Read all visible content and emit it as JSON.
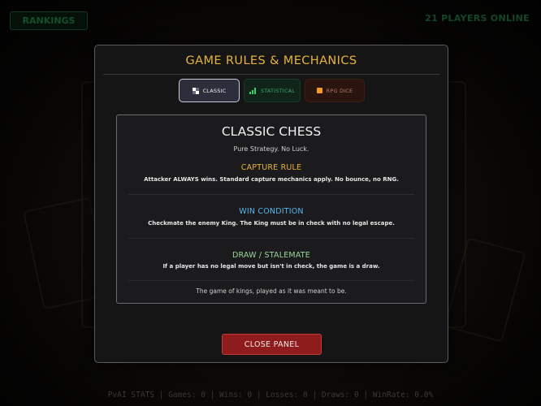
{
  "topbar": {
    "rankings_label": "RANKINGS",
    "online_text": "21 PLAYERS ONLINE"
  },
  "stats_bar": {
    "text": "PvAI STATS | Games: 0 | Wins: 0 | Losses: 0 | Draws: 0 | WinRate: 0.0%"
  },
  "modal": {
    "title": "GAME RULES & MECHANICS",
    "tabs": [
      {
        "label": "CLASSIC",
        "icon": "chessboard-icon",
        "selected": true
      },
      {
        "label": "STATISTICAL",
        "icon": "bar-chart-icon",
        "selected": false
      },
      {
        "label": "RPG DICE",
        "icon": "die-icon",
        "selected": false
      }
    ],
    "panel": {
      "title": "CLASSIC CHESS",
      "subtitle": "Pure Strategy. No Luck.",
      "sections": [
        {
          "heading": "CAPTURE RULE",
          "text": "Attacker ALWAYS wins. Standard capture mechanics apply. No bounce, no RNG.",
          "color": "#e8b33c"
        },
        {
          "heading": "WIN CONDITION",
          "text": "Checkmate the enemy King. The King must be in check with no legal escape.",
          "color": "#5ab4ee"
        },
        {
          "heading": "DRAW / STALEMATE",
          "text": "If a player has no legal move but isn't in check, the game is a draw.",
          "color": "#9ad69a"
        }
      ],
      "footer": "The game of kings, played as it was meant to be."
    },
    "close_label": "CLOSE PANEL"
  },
  "colors": {
    "accent_gold": "#e8b33c",
    "close_red": "#8e1c1c",
    "online_green": "#1f6e3b"
  }
}
